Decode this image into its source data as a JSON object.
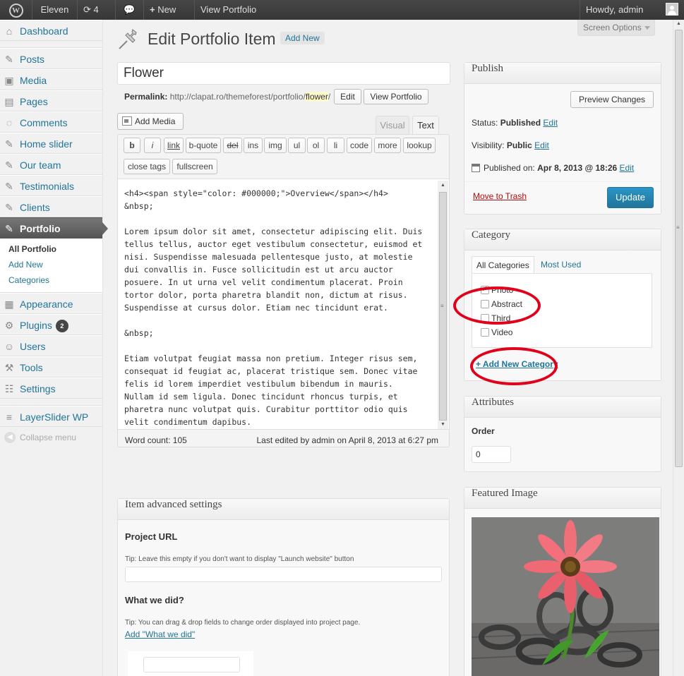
{
  "adminbar": {
    "logo": "W",
    "site": "Eleven",
    "updates_count": "4",
    "new_label": "New",
    "view_label": "View Portfolio",
    "howdy": "Howdy, admin"
  },
  "menu": {
    "dashboard": "Dashboard",
    "posts": "Posts",
    "media": "Media",
    "pages": "Pages",
    "comments": "Comments",
    "home_slider": "Home slider",
    "our_team": "Our team",
    "testimonials": "Testimonials",
    "clients": "Clients",
    "portfolio": "Portfolio",
    "sub": {
      "all": "All Portfolio",
      "add_new": "Add New",
      "categories": "Categories"
    },
    "appearance": "Appearance",
    "plugins": "Plugins",
    "plugins_badge": "2",
    "users": "Users",
    "tools": "Tools",
    "settings": "Settings",
    "layerslider": "LayerSlider WP",
    "collapse": "Collapse menu"
  },
  "screen_options": "Screen Options",
  "page": {
    "title": "Edit Portfolio Item",
    "add_new": "Add New"
  },
  "post": {
    "title": "Flower",
    "permalink_label": "Permalink:",
    "permalink_base": "http://clapat.ro/themeforest/portfolio/",
    "permalink_slug": "flower",
    "permalink_end": "/",
    "edit_btn": "Edit",
    "view_btn": "View Portfolio"
  },
  "editor": {
    "add_media": "Add Media",
    "tab_visual": "Visual",
    "tab_text": "Text",
    "buttons": [
      "b",
      "i",
      "link",
      "b-quote",
      "del",
      "ins",
      "img",
      "ul",
      "ol",
      "li",
      "code",
      "more",
      "lookup",
      "close tags",
      "fullscreen"
    ],
    "content": "<h4><span style=\"color: #000000;\">Overview</span></h4>\n&nbsp;\n\nLorem ipsum dolor sit amet, consectetur adipiscing elit. Duis\ntellus tellus, auctor eget vestibulum consectetur, euismod et\nnisi. Suspendisse malesuada pellentesque justo, at molestie\ndui convallis in. Fusce sollicitudin est ut arcu auctor\nposuere. In ut urna vel velit condimentum placerat. Proin\ntortor dolor, porta pharetra blandit non, dictum at risus.\nSuspendisse at cursus dolor. Etiam nec tincidunt erat.\n\n&nbsp;\n\nEtiam volutpat feugiat massa non pretium. Integer risus sem,\nconsequat id feugiat ac, placerat tristique sem. Donec vitae\nfelis id lorem imperdiet vestibulum bibendum in mauris.\nNullam id sem ligula. Donec tincidunt rhoncus turpis, et\npharetra nunc volutpat quis. Curabitur porttitor odio quis\nvelit condimentum dapibus.",
    "word_count": "Word count: 105",
    "last_edited": "Last edited by admin on April 8, 2013 at 6:27 pm"
  },
  "advanced": {
    "title": "Item advanced settings",
    "project_url_label": "Project URL",
    "project_url_tip": "Tip: Leave this empty if you don't want to display \"Launch website\" button",
    "what_we_did_label": "What we did?",
    "what_we_did_tip": "Tip: You can drag & drop fields to change order displayed into project page.",
    "add_what_we_did": "Add \"What we did\""
  },
  "publish": {
    "title": "Publish",
    "preview_btn": "Preview Changes",
    "status_label": "Status:",
    "status_value": "Published",
    "visibility_label": "Visibility:",
    "visibility_value": "Public",
    "published_on_label": "Published on:",
    "published_on_value": "Apr 8, 2013 @ 18:26",
    "edit": "Edit",
    "trash": "Move to Trash",
    "update": "Update"
  },
  "category": {
    "title": "Category",
    "tab_all": "All Categories",
    "tab_used": "Most Used",
    "items": [
      {
        "label": "Photo",
        "checked": true
      },
      {
        "label": "Abstract",
        "checked": false
      },
      {
        "label": "Third",
        "checked": false
      },
      {
        "label": "Video",
        "checked": false
      }
    ],
    "add_new": "+ Add New Category"
  },
  "attributes": {
    "title": "Attributes",
    "order_label": "Order",
    "order_value": "0"
  },
  "featured": {
    "title": "Featured Image"
  },
  "colors": {
    "link": "#21759b",
    "update_button": "#21759b",
    "trash": "#bc0b0b",
    "annotation": "#e0001a"
  }
}
